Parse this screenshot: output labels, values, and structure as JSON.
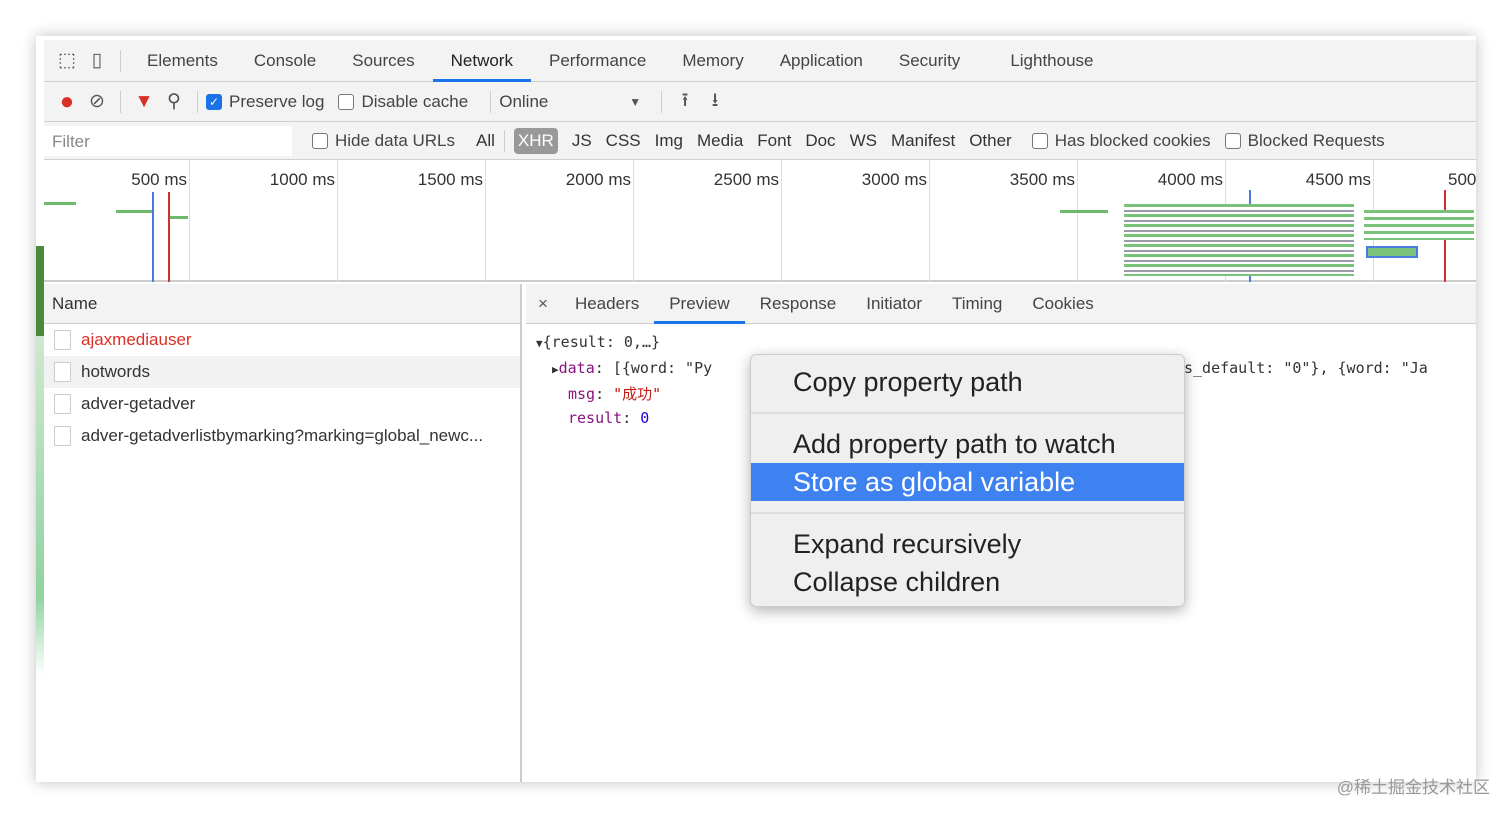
{
  "tabs": [
    "Elements",
    "Console",
    "Sources",
    "Network",
    "Performance",
    "Memory",
    "Application",
    "Security",
    "Lighthouse"
  ],
  "toolbar": {
    "preserve_log": "Preserve log",
    "disable_cache": "Disable cache",
    "throttle": "Online"
  },
  "filter": {
    "placeholder": "Filter",
    "hide_data_urls": "Hide data URLs",
    "types": [
      "All",
      "XHR",
      "JS",
      "CSS",
      "Img",
      "Media",
      "Font",
      "Doc",
      "WS",
      "Manifest",
      "Other"
    ],
    "has_blocked_cookies": "Has blocked cookies",
    "blocked_requests": "Blocked Requests"
  },
  "timeline": {
    "ticks": [
      "500 ms",
      "1000 ms",
      "1500 ms",
      "2000 ms",
      "2500 ms",
      "3000 ms",
      "3500 ms",
      "4000 ms",
      "4500 ms",
      "500"
    ]
  },
  "requests": {
    "header": "Name",
    "items": [
      "ajaxmediauser",
      "hotwords",
      "adver-getadver",
      "adver-getadverlistbymarking?marking=global_newc..."
    ]
  },
  "details": {
    "close": "×",
    "tabs": [
      "Headers",
      "Preview",
      "Response",
      "Initiator",
      "Timing",
      "Cookies"
    ],
    "preview": {
      "root": "{result: 0,…}",
      "data_key": "data",
      "data_val": "[{word: \"Py",
      "data_tail": "s_default: \"0\"}, {word: \"Ja",
      "msg_key": "msg",
      "msg_val": "\"成功\"",
      "result_key": "result",
      "result_val": "0"
    }
  },
  "context_menu": [
    "Copy property path",
    "Add property path to watch",
    "Store as global variable",
    "Expand recursively",
    "Collapse children"
  ],
  "watermark": "@稀土掘金技术社区"
}
